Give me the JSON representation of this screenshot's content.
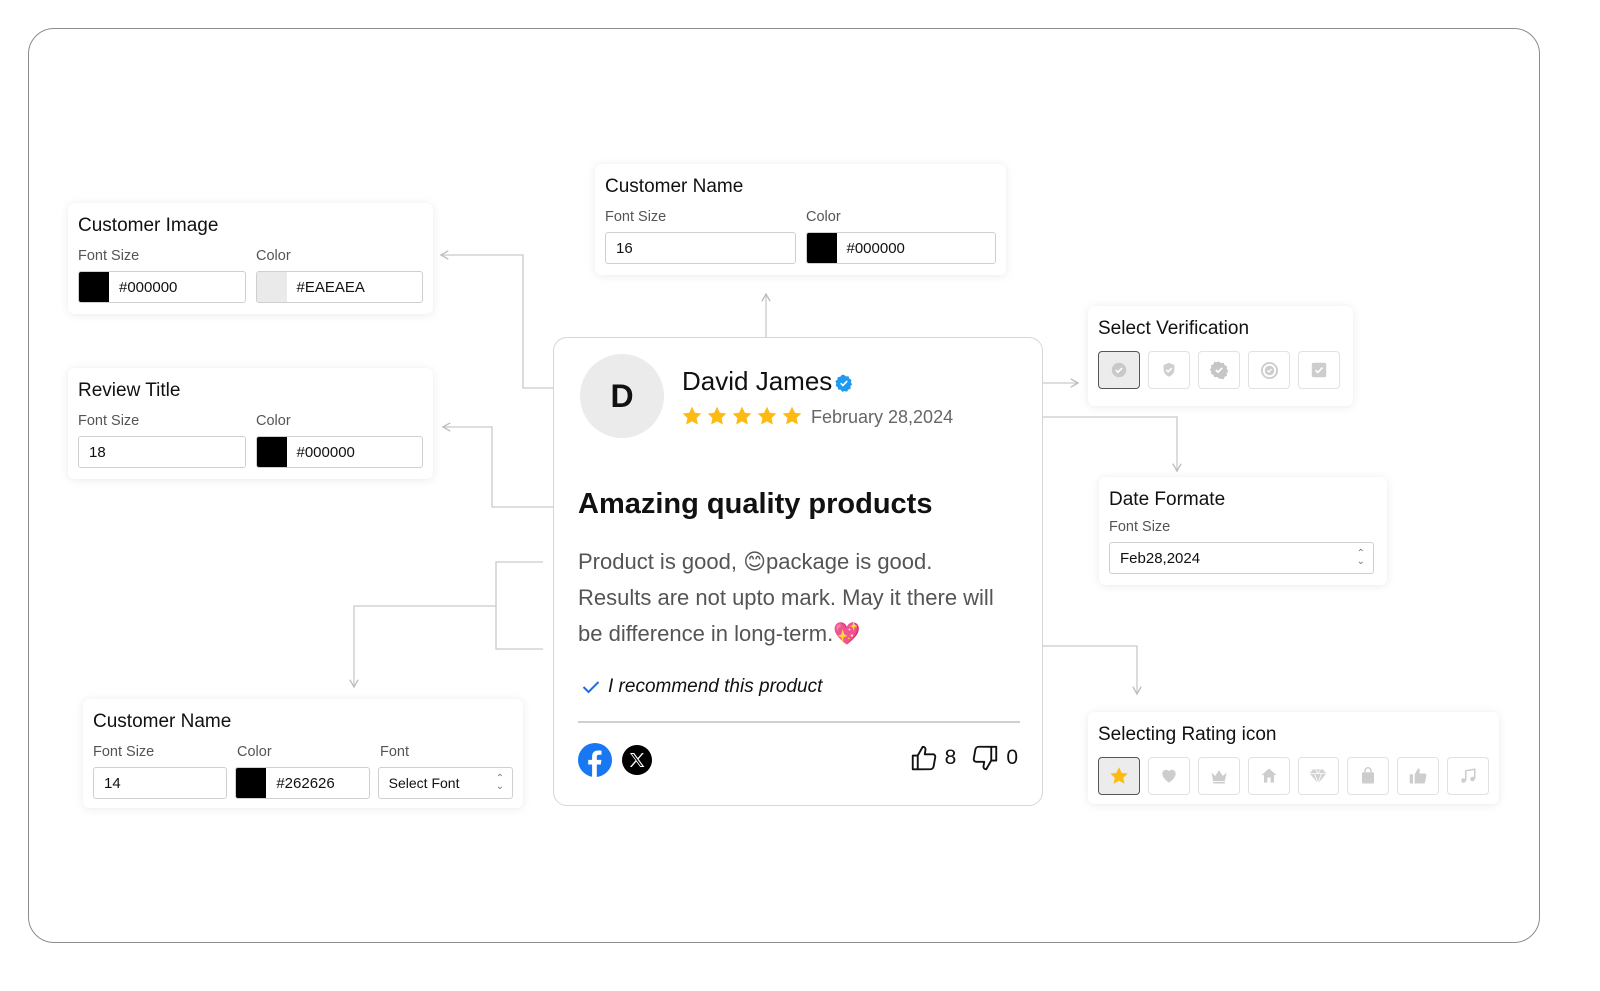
{
  "panels": {
    "customer_image": {
      "title": "Customer Image",
      "label_1": "Font Size",
      "label_2": "Color",
      "field_1_value": "#000000",
      "field_1_swatch": "#000000",
      "field_2_value": "#EAEAEA",
      "field_2_swatch": "#EAEAEA"
    },
    "review_title": {
      "title": "Review Title",
      "label_1": "Font Size",
      "label_2": "Color",
      "font_size_value": "18",
      "color_value": "#000000",
      "color_swatch": "#000000"
    },
    "customer_name_top": {
      "title": "Customer Name",
      "label_1": "Font Size",
      "label_2": "Color",
      "font_size_value": "16",
      "color_value": "#000000",
      "color_swatch": "#000000"
    },
    "customer_name_bottom": {
      "title": "Customer Name",
      "label_1": "Font Size",
      "label_2": "Color",
      "label_3": "Font",
      "font_size_value": "14",
      "color_value": "#262626",
      "color_swatch": "#000000",
      "font_select_value": "Select Font"
    },
    "select_verification": {
      "title": "Select Verification",
      "icons": [
        "check-circle-icon",
        "shield-check-icon",
        "badge-check-icon",
        "target-check-icon",
        "square-check-icon"
      ],
      "selected_index": 0
    },
    "date_format": {
      "title": "Date Formate",
      "label_1": "Font Size",
      "select_value": "Feb28,2024"
    },
    "rating_icon": {
      "title": "Selecting Rating icon",
      "icons": [
        "star-icon",
        "heart-icon",
        "crown-icon",
        "home-icon",
        "diamond-icon",
        "bag-icon",
        "thumbs-up-icon",
        "music-note-icon"
      ],
      "selected_index": 0
    }
  },
  "review": {
    "avatar_initial": "D",
    "name": "David James",
    "rating": 5,
    "rating_max": 5,
    "date": "February 28,2024",
    "title": "Amazing quality products",
    "body": "Product is good, 😊package is good. Results are not upto mark. May it there will be difference in long-term.💖",
    "recommend_text": "I recommend this product",
    "likes": "8",
    "dislikes": "0",
    "share_icons": [
      "facebook-icon",
      "x-twitter-icon"
    ]
  },
  "colors": {
    "verified": "#1E9BF0",
    "star": "#FDBA12",
    "facebook": "#1877F2",
    "recommend_check": "#1E6FD9"
  }
}
